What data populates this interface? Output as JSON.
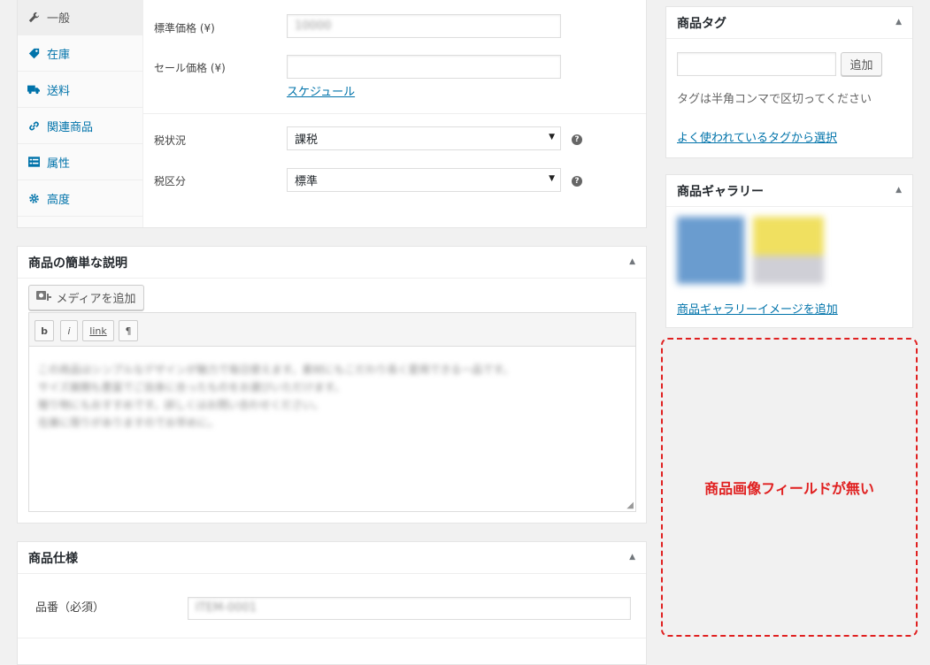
{
  "product_data": {
    "tabs": [
      {
        "label": "一般",
        "icon": "wrench-icon",
        "active": true
      },
      {
        "label": "在庫",
        "icon": "tag-icon",
        "active": false
      },
      {
        "label": "送料",
        "icon": "truck-icon",
        "active": false
      },
      {
        "label": "関連商品",
        "icon": "link-icon",
        "active": false
      },
      {
        "label": "属性",
        "icon": "list-icon",
        "active": false
      },
      {
        "label": "高度",
        "icon": "gear-icon",
        "active": false
      }
    ],
    "regular_price_label": "標準価格 (¥)",
    "regular_price_value": "10000",
    "sale_price_label": "セール価格 (¥)",
    "sale_price_value": "",
    "schedule_link": "スケジュール",
    "tax_status_label": "税状況",
    "tax_status_value": "課税",
    "tax_class_label": "税区分",
    "tax_class_value": "標準",
    "help_glyph": "?"
  },
  "short_description": {
    "title": "商品の簡単な説明",
    "add_media_label": "メディアを追加",
    "quicktags": [
      "b",
      "i",
      "link",
      "¶"
    ],
    "text_lines": [
      "この商品はシンプルなデザインが魅力で毎日使えます。素材にもこだわり長く愛用できる一品です。",
      "サイズ展開も豊富でご自身に合ったものをお選びいただけます。",
      "贈り物にもおすすめです。詳しくはお問い合わせください。",
      "在庫に限りがありますのでお早めに。"
    ]
  },
  "product_spec": {
    "title": "商品仕様",
    "part_number_label": "品番（必須）",
    "part_number_value": "ITEM-0001"
  },
  "product_tags": {
    "title": "商品タグ",
    "add_button": "追加",
    "hint": "タグは半角コンマで区切ってください",
    "popular_link": "よく使われているタグから選択"
  },
  "product_gallery": {
    "title": "商品ギャラリー",
    "add_link": "商品ギャラリーイメージを追加"
  },
  "annotation": {
    "text": "商品画像フィールドが無い"
  }
}
